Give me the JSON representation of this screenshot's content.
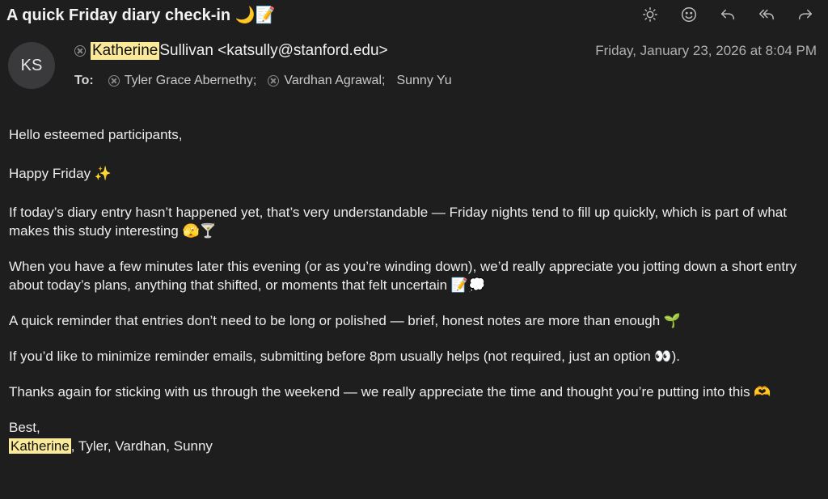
{
  "email": {
    "subject": "A quick Friday diary check-in 🌙📝",
    "sender": {
      "initials": "KS",
      "first_name": "Katherine",
      "rest": " Sullivan <katsully@stanford.edu>"
    },
    "date": "Friday, January 23, 2026 at 8:04 PM",
    "to_label": "To:",
    "recipients": [
      "Tyler Grace Abernethy;",
      "Vardhan Agrawal;",
      "Sunny Yu"
    ],
    "body": {
      "greeting": "Hello esteemed participants,",
      "happy": "Happy Friday ✨",
      "p1": "If today’s diary entry hasn’t happened yet, that’s very understandable — Friday nights tend to fill up quickly, which is part of what makes this study interesting 🫣🍸",
      "p2": "When you have a few minutes later this evening (or as you’re winding down), we’d really appreciate you jotting down a short entry about today’s plans, anything that shifted, or moments that felt uncertain 📝💭",
      "p3": "A quick reminder that entries don’t need to be long or polished — brief, honest notes are more than enough 🌱",
      "p4": "If you’d like to minimize reminder emails, submitting before 8pm usually helps (not required, just an option 👀).",
      "p5": "Thanks again for sticking with us through the weekend — we really appreciate the time and thought you’re putting into this 🫶",
      "signoff": "Best,",
      "signature_highlight": "Katherine",
      "signature_rest": ", Tyler, Vardhan, Sunny"
    }
  },
  "toolbar": {
    "icons": [
      "sun-icon",
      "smiley-icon",
      "reply-icon",
      "reply-all-icon",
      "forward-icon"
    ]
  },
  "colors": {
    "background": "#1e1e1e",
    "highlight": "#fbe99a",
    "avatar_bg": "#3a3a3c"
  }
}
